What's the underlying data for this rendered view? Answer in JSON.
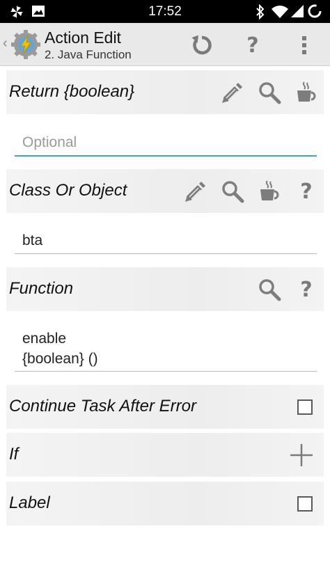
{
  "status_bar": {
    "time": "17:52",
    "left_icons": [
      "pinwheel-icon",
      "image-icon"
    ],
    "right_icons": [
      "bluetooth-icon",
      "wifi-icon",
      "signal-icon",
      "battery-icon"
    ]
  },
  "action_bar": {
    "title": "Action Edit",
    "subtitle": "2. Java Function",
    "buttons": [
      "refresh-icon",
      "help-icon",
      "overflow-menu-icon"
    ]
  },
  "sections": {
    "return": {
      "label": "Return {boolean}",
      "placeholder": "Optional",
      "value": ""
    },
    "class_or_object": {
      "label": "Class Or Object",
      "value": "bta"
    },
    "function": {
      "label": "Function",
      "value_line1": "enable",
      "value_line2": "{boolean} ()"
    },
    "continue_task": {
      "label": "Continue Task After Error",
      "checked": false
    },
    "if": {
      "label": "If"
    },
    "label": {
      "label": "Label",
      "checked": false
    }
  },
  "glyphs": {
    "help": "?"
  },
  "colors": {
    "accent_underline": "#3fa6b8",
    "header_bg": "#ededed",
    "status_bar": "#000000"
  }
}
